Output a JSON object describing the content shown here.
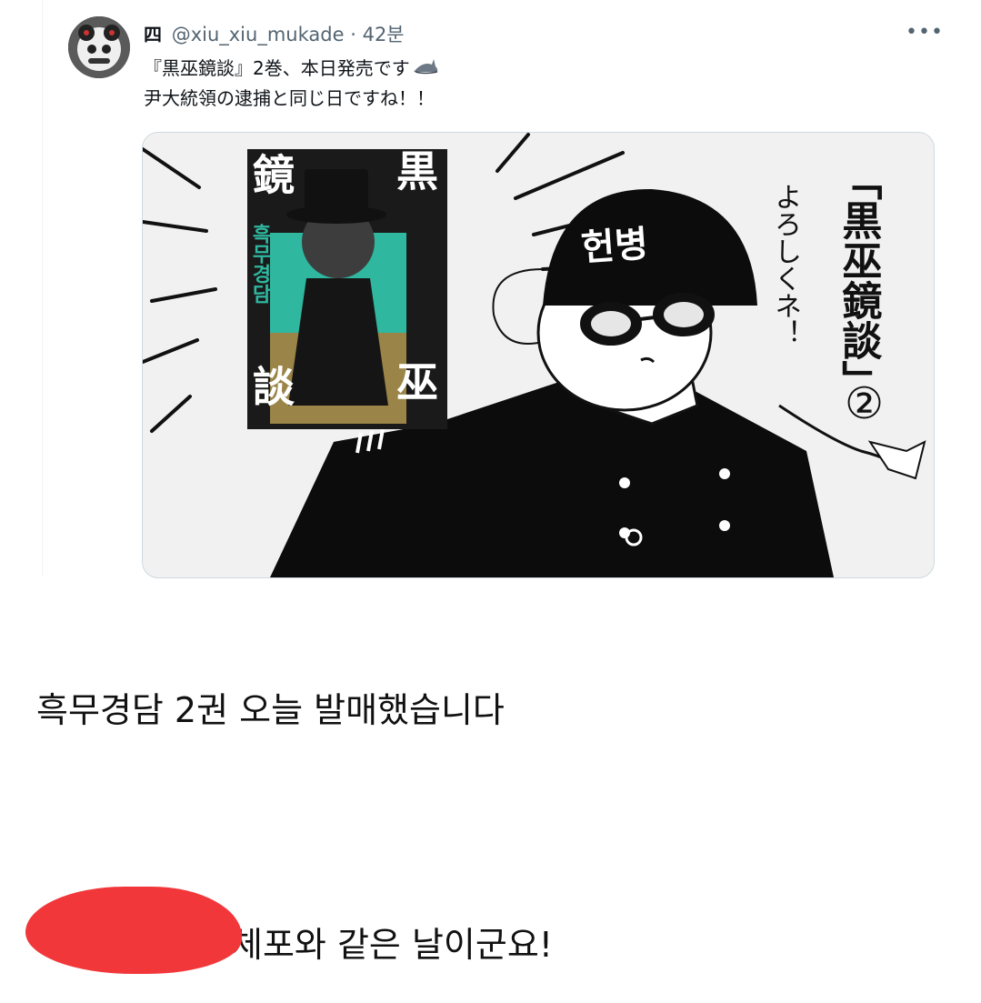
{
  "tweet": {
    "display_name": "四",
    "handle": "@xiu_xiu_mukade",
    "separator": "·",
    "time": "42분",
    "more_icon": "more-dots-icon",
    "text_line1": "『黒巫鏡談』2巻、本日発売です",
    "text_line2": "尹大統領の逮捕と同じ日ですね！！",
    "emoji": "shark-icon"
  },
  "media": {
    "book_title_top": "黒",
    "book_title_left": "鏡",
    "book_title_left2": "談",
    "book_title_right": "巫",
    "book_subtitle": "흑무경담",
    "helmet_text": "헌병",
    "side_title": "「黒巫鏡談」",
    "side_number": "②",
    "side_note": "よろしくネ！"
  },
  "captions": {
    "line1": "흑무경담 2권 오늘 발매했습니다",
    "line2_visible": "체포와 같은 날이군요!"
  },
  "colors": {
    "redaction": "#f2373a",
    "book_teal": "#2fb7a0",
    "book_gold": "#9a8447"
  }
}
